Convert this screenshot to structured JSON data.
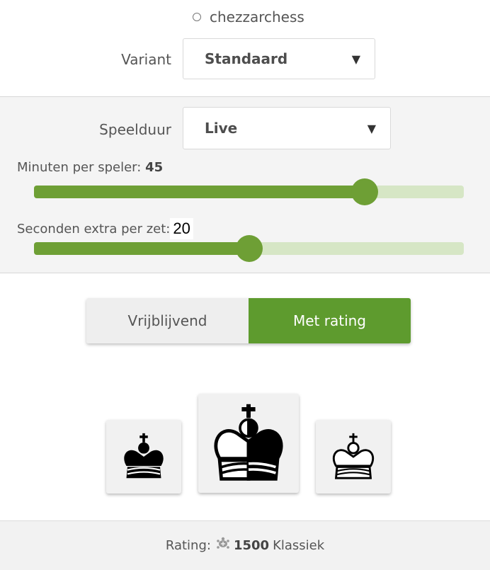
{
  "opponent": {
    "label": "chezzarchess"
  },
  "variant": {
    "label": "Variant",
    "value": "Standaard"
  },
  "time_control": {
    "label": "Speelduur",
    "value": "Live",
    "minutes": {
      "label": "Minuten per speler:",
      "value": "45",
      "fraction": 0.77
    },
    "increment": {
      "label": "Seconden extra per zet:",
      "value": "20",
      "fraction": 0.5
    }
  },
  "mode": {
    "casual": "Vrijblijvend",
    "rated": "Met rating",
    "selected": "rated"
  },
  "colors": [
    "black",
    "random",
    "white"
  ],
  "footer": {
    "prefix": "Rating:",
    "rating": "1500",
    "category": "Klassiek"
  },
  "theme": {
    "accent": "#5e9b2e",
    "track": "#d6e6c5"
  }
}
